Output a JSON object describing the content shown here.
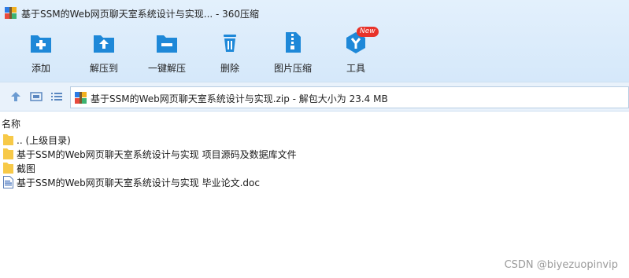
{
  "window": {
    "title": "基于SSM的Web网页聊天室系统设计与实现... - 360压缩"
  },
  "toolbar": {
    "items": [
      {
        "label": "添加",
        "icon": "add-icon"
      },
      {
        "label": "解压到",
        "icon": "extract-to-icon"
      },
      {
        "label": "一键解压",
        "icon": "one-click-extract-icon"
      },
      {
        "label": "删除",
        "icon": "delete-icon"
      },
      {
        "label": "图片压缩",
        "icon": "image-compress-icon"
      },
      {
        "label": "工具",
        "icon": "tools-icon",
        "badge": "New"
      }
    ]
  },
  "nav": {
    "up_icon": "up-arrow-icon",
    "view_icon": "view-mode-icon",
    "list_icon": "list-view-icon",
    "address": "基于SSM的Web网页聊天室系统设计与实现.zip - 解包大小为 23.4 MB"
  },
  "list": {
    "column_name": "名称",
    "items": [
      {
        "name": ".. (上级目录)",
        "type": "folder"
      },
      {
        "name": "基于SSM的Web网页聊天室系统设计与实现 项目源码及数据库文件",
        "type": "folder"
      },
      {
        "name": "截图",
        "type": "folder"
      },
      {
        "name": "基于SSM的Web网页聊天室系统设计与实现 毕业论文.doc",
        "type": "doc"
      }
    ]
  },
  "watermark": "CSDN @biyezuopinvip",
  "colors": {
    "accent_blue": "#1e88d8",
    "badge_red": "#e8332a",
    "folder_yellow": "#f7c948"
  }
}
